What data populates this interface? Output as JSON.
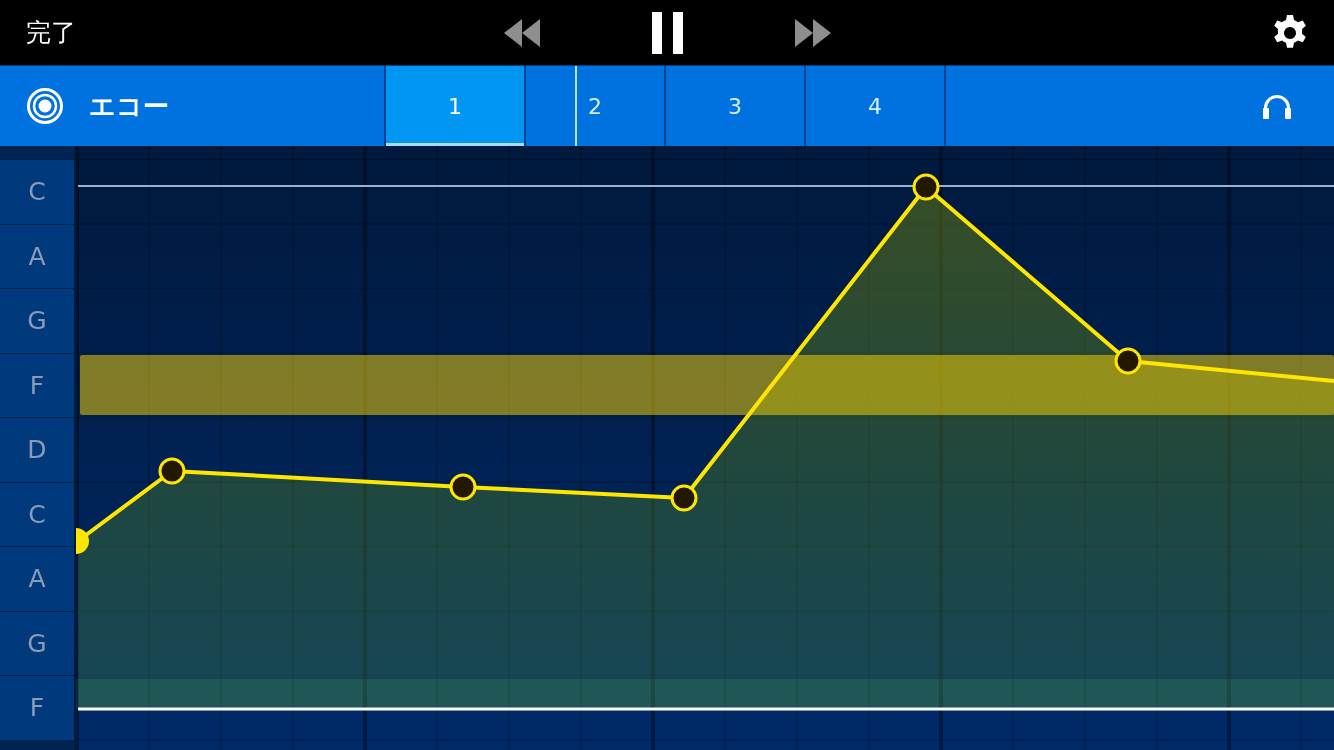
{
  "toolbar": {
    "done_label": "完了",
    "transport": [
      {
        "kind": "rewind",
        "disabled": true
      },
      {
        "kind": "pause",
        "disabled": false
      },
      {
        "kind": "fast_forward",
        "disabled": true
      }
    ]
  },
  "track_bar": {
    "title": "エコー",
    "sections": [
      {
        "label": "1",
        "selected": true
      },
      {
        "label": "2",
        "selected": false
      },
      {
        "label": "3",
        "selected": false
      },
      {
        "label": "4",
        "selected": false
      }
    ]
  },
  "pitch_rows": [
    {
      "label": "C",
      "highlighted": false
    },
    {
      "label": "A",
      "highlighted": false
    },
    {
      "label": "G",
      "highlighted": false
    },
    {
      "label": "F",
      "highlighted": true
    },
    {
      "label": "D",
      "highlighted": false
    },
    {
      "label": "C",
      "highlighted": false
    },
    {
      "label": "A",
      "highlighted": false
    },
    {
      "label": "G",
      "highlighted": false
    },
    {
      "label": "F",
      "highlighted": false
    }
  ]
}
